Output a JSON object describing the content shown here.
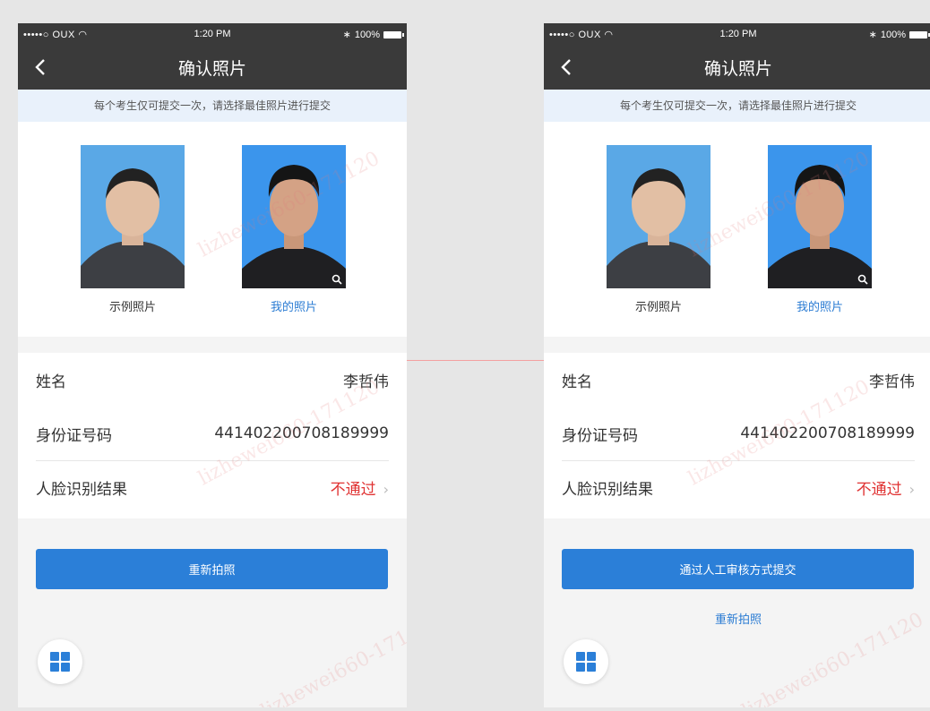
{
  "status_bar": {
    "carrier": "•••••○ OUX",
    "time": "1:20 PM",
    "battery": "100%"
  },
  "nav": {
    "title": "确认照片"
  },
  "notice": "每个考生仅可提交一次，请选择最佳照片进行提交",
  "photos": {
    "sample_label": "示例照片",
    "mine_label": "我的照片"
  },
  "info": {
    "name_label": "姓名",
    "name_value": "李哲伟",
    "id_label": "身份证号码",
    "id_value": "441402200708189999",
    "face_label": "人脸识别结果",
    "face_value": "不通过"
  },
  "left_screen": {
    "primary_button": "重新拍照"
  },
  "right_screen": {
    "primary_button": "通过人工审核方式提交",
    "secondary_link": "重新拍照"
  },
  "watermark": "lizhewei660-171120",
  "colors": {
    "accent": "#2b7fd8",
    "fail": "#e03333",
    "header": "#3a3a3a",
    "notice_bg": "#e9f1fb"
  }
}
